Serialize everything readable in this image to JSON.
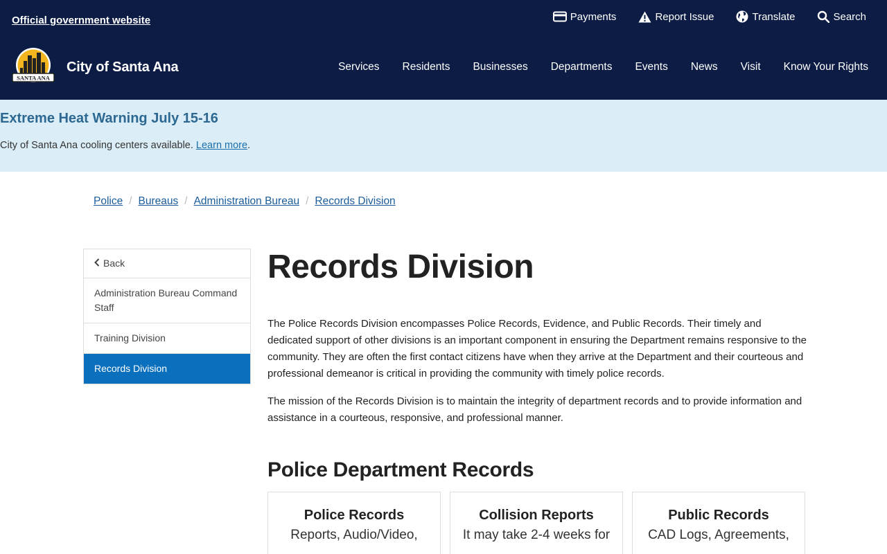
{
  "header": {
    "official": "Official government website",
    "utility": [
      {
        "label": "Payments",
        "icon": "credit-card-icon"
      },
      {
        "label": "Report Issue",
        "icon": "warning-icon"
      },
      {
        "label": "Translate",
        "icon": "globe-icon"
      },
      {
        "label": "Search",
        "icon": "search-icon"
      }
    ],
    "logo_text": "SANTA ANA",
    "site_name": "City of Santa Ana",
    "nav": [
      "Services",
      "Residents",
      "Businesses",
      "Departments",
      "Events",
      "News",
      "Visit",
      "Know Your Rights"
    ]
  },
  "alert": {
    "title": "Extreme Heat Warning July 15-16",
    "text": "City of Santa Ana cooling centers available. ",
    "link": "Learn more",
    "trailing": "."
  },
  "breadcrumb": [
    "Police",
    "Bureaus",
    "Administration Bureau",
    "Records Division"
  ],
  "sidenav": {
    "back": "Back",
    "items": [
      "Administration Bureau Command Staff",
      "Training Division",
      "Records Division"
    ]
  },
  "main": {
    "title": "Records Division",
    "para1": "The Police Records Division encompasses Police Records, Evidence, and Public Records.  Their timely and dedicated support of other divisions is an important component in ensuring the Department remains responsive to the community. They are often the first contact citizens have when they arrive at the Department and their courteous and professional demeanor is critical in providing the community with timely police records.",
    "para2": "The mission of the Records Division is to maintain the integrity of department records and to provide information and assistance in a courteous, responsive, and professional manner.",
    "section_title": "Police Department Records",
    "cards": [
      {
        "title": "Police Records",
        "text": "Reports, Audio/Video,"
      },
      {
        "title": "Collision Reports",
        "text": "It may take 2-4 weeks for"
      },
      {
        "title": "Public Records",
        "text": "CAD Logs, Agreements,"
      }
    ]
  },
  "colors": {
    "header_bg": "#0c1c45",
    "alert_bg": "#dbeef7",
    "active_nav": "#0a6fbd",
    "link": "#1b5c9a"
  }
}
